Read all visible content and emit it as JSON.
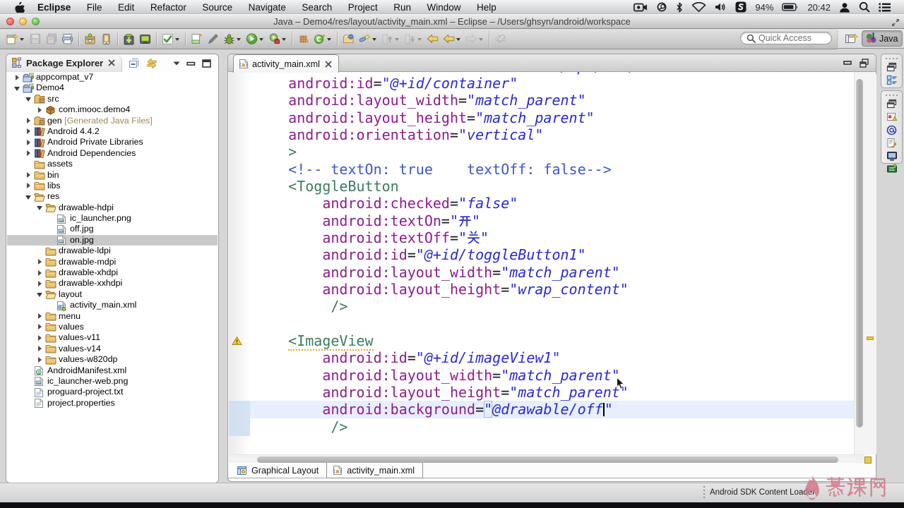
{
  "menubar": {
    "apple_icon": "apple-icon",
    "items": [
      "Eclipse",
      "File",
      "Edit",
      "Refactor",
      "Source",
      "Navigate",
      "Search",
      "Project",
      "Run",
      "Window",
      "Help"
    ],
    "tray": [
      {
        "icon": "screen-recording-icon"
      },
      {
        "icon": "app-circle-icon"
      },
      {
        "icon": "bluetooth-icon"
      },
      {
        "icon": "wifi-icon"
      },
      {
        "icon": "volume-icon"
      },
      {
        "icon": "input-method-icon"
      },
      {
        "text": "94%"
      },
      {
        "icon": "battery-icon"
      },
      {
        "text": "20:42"
      },
      {
        "icon": "user-icon"
      },
      {
        "icon": "spotlight-icon"
      },
      {
        "icon": "notification-center-icon"
      }
    ]
  },
  "titlebar": {
    "title": "Java – Demo4/res/layout/activity_main.xml – Eclipse – /Users/ghsyn/android/workspace"
  },
  "toolbar": {
    "buttons": [
      {
        "name": "new-wizard",
        "icon": "new-wizard-icon",
        "caret": true
      },
      {
        "name": "save",
        "icon": "save-icon",
        "disabled": true
      },
      {
        "name": "save-all",
        "icon": "save-all-icon",
        "disabled": true
      },
      {
        "name": "print",
        "icon": "print-icon"
      },
      {
        "sep": true
      },
      {
        "name": "android-sdk-manager",
        "icon": "android-sdk-icon"
      },
      {
        "name": "avd-manager",
        "icon": "avd-device-icon"
      },
      {
        "sep": true
      },
      {
        "name": "sdk-download",
        "icon": "sdk-download-icon"
      },
      {
        "name": "device-screen-capture",
        "icon": "device-screen-icon"
      },
      {
        "sep": true
      },
      {
        "name": "new-test",
        "icon": "check-xml-icon",
        "caret": true
      },
      {
        "sep": true
      },
      {
        "name": "new-android-xml",
        "icon": "xml-new-icon"
      },
      {
        "name": "toggle-mark-occurrences",
        "icon": "mark-occurrences-icon"
      },
      {
        "name": "debug",
        "icon": "debug-icon",
        "caret": true
      },
      {
        "name": "run",
        "icon": "run-icon",
        "caret": true
      },
      {
        "name": "external-tools",
        "icon": "external-tools-icon",
        "caret": true
      },
      {
        "sep": true
      },
      {
        "name": "coverage",
        "icon": "coverage-icon"
      },
      {
        "name": "new-class",
        "icon": "new-class-icon",
        "caret": true
      },
      {
        "sep": true
      },
      {
        "name": "open-task",
        "icon": "open-task-icon"
      },
      {
        "name": "search",
        "icon": "search-flashlight-icon",
        "caret": true
      },
      {
        "name": "previous-annotation",
        "icon": "prev-annotation-icon",
        "caret": true,
        "disabled": true
      },
      {
        "name": "next-annotation",
        "icon": "next-annotation-icon",
        "caret": true,
        "disabled": true
      },
      {
        "name": "back",
        "icon": "back-arrow-icon"
      },
      {
        "name": "back-history",
        "icon": "back-arrow-icon",
        "caret": true
      },
      {
        "name": "forward",
        "icon": "forward-arrow-icon",
        "caret": true,
        "disabled": true
      },
      {
        "sep": true,
        "tall": true
      },
      {
        "name": "last-edit-location",
        "icon": "last-edit-icon",
        "disabled": true
      }
    ],
    "quick_access": {
      "placeholder": "Quick Access",
      "icon": "search-icon"
    },
    "perspectives": {
      "open_icon": "open-perspective-icon",
      "java_label": "Java",
      "java_icon": "java-perspective-icon"
    }
  },
  "explorer": {
    "title": "Package Explorer",
    "icon": "package-explorer-icon",
    "tools": [
      "collapse-all-icon",
      "link-editor-icon",
      "view-menu-icon",
      "minimize-icon",
      "maximize-icon"
    ],
    "tree": [
      {
        "label": "appcompat_v7",
        "level": 0,
        "arrow": "right",
        "icon": "project-icon"
      },
      {
        "label": "Demo4",
        "level": 0,
        "arrow": "down",
        "icon": "project-icon"
      },
      {
        "label": "src",
        "level": 1,
        "arrow": "down",
        "icon": "source-folder-icon"
      },
      {
        "label": "com.imooc.demo4",
        "level": 2,
        "arrow": "right",
        "icon": "package-icon"
      },
      {
        "label": "gen",
        "suffix": " [Generated Java Files]",
        "level": 1,
        "arrow": "right",
        "icon": "source-folder-icon"
      },
      {
        "label": "Android 4.4.2",
        "level": 1,
        "arrow": "right",
        "icon": "library-icon"
      },
      {
        "label": "Android Private Libraries",
        "level": 1,
        "arrow": "right",
        "icon": "library-icon"
      },
      {
        "label": "Android Dependencies",
        "level": 1,
        "arrow": "right",
        "icon": "library-icon"
      },
      {
        "label": "assets",
        "level": 1,
        "arrow": "none",
        "icon": "folder-icon"
      },
      {
        "label": "bin",
        "level": 1,
        "arrow": "right",
        "icon": "folder-icon"
      },
      {
        "label": "libs",
        "level": 1,
        "arrow": "right",
        "icon": "folder-icon"
      },
      {
        "label": "res",
        "level": 1,
        "arrow": "down",
        "icon": "folder-open-icon"
      },
      {
        "label": "drawable-hdpi",
        "level": 2,
        "arrow": "down",
        "icon": "folder-open-icon"
      },
      {
        "label": "ic_launcher.png",
        "level": 3,
        "arrow": "none",
        "icon": "image-file-icon"
      },
      {
        "label": "off.jpg",
        "level": 3,
        "arrow": "none",
        "icon": "image-file-icon"
      },
      {
        "label": "on.jpg",
        "level": 3,
        "arrow": "none",
        "icon": "image-file-icon",
        "selected": true
      },
      {
        "label": "drawable-ldpi",
        "level": 2,
        "arrow": "none",
        "icon": "folder-icon"
      },
      {
        "label": "drawable-mdpi",
        "level": 2,
        "arrow": "right",
        "icon": "folder-icon"
      },
      {
        "label": "drawable-xhdpi",
        "level": 2,
        "arrow": "right",
        "icon": "folder-icon"
      },
      {
        "label": "drawable-xxhdpi",
        "level": 2,
        "arrow": "right",
        "icon": "folder-icon"
      },
      {
        "label": "layout",
        "level": 2,
        "arrow": "down",
        "icon": "folder-open-icon"
      },
      {
        "label": "activity_main.xml",
        "level": 3,
        "arrow": "none",
        "icon": "layout-file-icon"
      },
      {
        "label": "menu",
        "level": 2,
        "arrow": "right",
        "icon": "folder-icon"
      },
      {
        "label": "values",
        "level": 2,
        "arrow": "right",
        "icon": "folder-icon"
      },
      {
        "label": "values-v11",
        "level": 2,
        "arrow": "right",
        "icon": "folder-icon"
      },
      {
        "label": "values-v14",
        "level": 2,
        "arrow": "right",
        "icon": "folder-icon"
      },
      {
        "label": "values-w820dp",
        "level": 2,
        "arrow": "right",
        "icon": "folder-icon"
      },
      {
        "label": "AndroidManifest.xml",
        "level": 1,
        "arrow": "none",
        "icon": "manifest-file-icon"
      },
      {
        "label": "ic_launcher-web.png",
        "level": 1,
        "arrow": "none",
        "icon": "image-file-icon"
      },
      {
        "label": "proguard-project.txt",
        "level": 1,
        "arrow": "none",
        "icon": "text-file-icon"
      },
      {
        "label": "project.properties",
        "level": 1,
        "arrow": "none",
        "icon": "text-file-icon"
      }
    ]
  },
  "editor": {
    "tab_label": "activity_main.xml",
    "tab_icon": "xml-file-icon",
    "lines": [
      {
        "tokens": [
          {
            "s": "    ",
            "c": "p"
          },
          {
            "s": "xmlns:tools",
            "c": "a"
          },
          {
            "s": "=",
            "c": "p"
          },
          {
            "s": "\"schemas.android.com/apk/res/android\"",
            "c": "v"
          }
        ]
      },
      {
        "tokens": [
          {
            "s": "    ",
            "c": "p"
          },
          {
            "s": "android:id",
            "c": "a"
          },
          {
            "s": "=",
            "c": "p"
          },
          {
            "s": "\"@+id/container\"",
            "c": "v"
          }
        ]
      },
      {
        "tokens": [
          {
            "s": "    ",
            "c": "p"
          },
          {
            "s": "android:layout_width",
            "c": "a"
          },
          {
            "s": "=",
            "c": "p"
          },
          {
            "s": "\"match_parent\"",
            "c": "v"
          }
        ]
      },
      {
        "tokens": [
          {
            "s": "    ",
            "c": "p"
          },
          {
            "s": "android:layout_height",
            "c": "a"
          },
          {
            "s": "=",
            "c": "p"
          },
          {
            "s": "\"match_parent\"",
            "c": "v"
          }
        ]
      },
      {
        "tokens": [
          {
            "s": "    ",
            "c": "p"
          },
          {
            "s": "android:orientation",
            "c": "a"
          },
          {
            "s": "=",
            "c": "p"
          },
          {
            "s": "\"vertical\"",
            "c": "v"
          }
        ]
      },
      {
        "tokens": [
          {
            "s": "    ",
            "c": "p"
          },
          {
            "s": ">",
            "c": "t"
          }
        ]
      },
      {
        "tokens": [
          {
            "s": "    ",
            "c": "p"
          },
          {
            "s": "<!-- textOn: true    textOff: false-->",
            "c": "c"
          }
        ]
      },
      {
        "tokens": [
          {
            "s": "    ",
            "c": "p"
          },
          {
            "s": "<ToggleButton",
            "c": "t"
          }
        ]
      },
      {
        "tokens": [
          {
            "s": "        ",
            "c": "p"
          },
          {
            "s": "android:checked",
            "c": "a"
          },
          {
            "s": "=",
            "c": "p"
          },
          {
            "s": "\"false\"",
            "c": "v"
          }
        ]
      },
      {
        "tokens": [
          {
            "s": "        ",
            "c": "p"
          },
          {
            "s": "android:textOn",
            "c": "a"
          },
          {
            "s": "=",
            "c": "p"
          },
          {
            "s": "\"开\"",
            "c": "v"
          }
        ]
      },
      {
        "tokens": [
          {
            "s": "        ",
            "c": "p"
          },
          {
            "s": "android:textOff",
            "c": "a"
          },
          {
            "s": "=",
            "c": "p"
          },
          {
            "s": "\"关\"",
            "c": "v"
          }
        ]
      },
      {
        "tokens": [
          {
            "s": "        ",
            "c": "p"
          },
          {
            "s": "android:id",
            "c": "a"
          },
          {
            "s": "=",
            "c": "p"
          },
          {
            "s": "\"@+id/toggleButton1\"",
            "c": "v"
          }
        ]
      },
      {
        "tokens": [
          {
            "s": "        ",
            "c": "p"
          },
          {
            "s": "android:layout_width",
            "c": "a"
          },
          {
            "s": "=",
            "c": "p"
          },
          {
            "s": "\"match_parent\"",
            "c": "v"
          }
        ]
      },
      {
        "tokens": [
          {
            "s": "        ",
            "c": "p"
          },
          {
            "s": "android:layout_height",
            "c": "a"
          },
          {
            "s": "=",
            "c": "p"
          },
          {
            "s": "\"wrap_content\"",
            "c": "v"
          }
        ]
      },
      {
        "tokens": [
          {
            "s": "         ",
            "c": "p"
          },
          {
            "s": "/>",
            "c": "t"
          }
        ]
      },
      {
        "tokens": []
      },
      {
        "tokens": [
          {
            "s": "    ",
            "c": "p"
          },
          {
            "s": "<ImageView",
            "c": "t",
            "warn": true
          }
        ]
      },
      {
        "tokens": [
          {
            "s": "        ",
            "c": "p"
          },
          {
            "s": "android:id",
            "c": "a"
          },
          {
            "s": "=",
            "c": "p"
          },
          {
            "s": "\"@+id/imageView1\"",
            "c": "v"
          }
        ]
      },
      {
        "tokens": [
          {
            "s": "        ",
            "c": "p"
          },
          {
            "s": "android:layout_width",
            "c": "a"
          },
          {
            "s": "=",
            "c": "p"
          },
          {
            "s": "\"match_parent\"",
            "c": "v"
          }
        ]
      },
      {
        "tokens": [
          {
            "s": "        ",
            "c": "p"
          },
          {
            "s": "android:layout_height",
            "c": "a"
          },
          {
            "s": "=",
            "c": "p"
          },
          {
            "s": "\"match_parent\"",
            "c": "v"
          }
        ]
      },
      {
        "current": true,
        "tokens": [
          {
            "s": "        ",
            "c": "p"
          },
          {
            "s": "android:background",
            "c": "a"
          },
          {
            "s": "=",
            "c": "p"
          },
          {
            "s": "\"",
            "c": "v",
            "box": true
          },
          {
            "s": "@drawable/off",
            "c": "v"
          },
          {
            "caret": true
          },
          {
            "s": "\"",
            "c": "v"
          }
        ]
      },
      {
        "tokens": [
          {
            "s": "         ",
            "c": "p"
          },
          {
            "s": "/>",
            "c": "t"
          }
        ]
      }
    ],
    "bottom_tabs": [
      {
        "label": "Graphical Layout",
        "icon": "graphical-layout-icon",
        "active": false
      },
      {
        "label": "activity_main.xml",
        "icon": "xml-file-icon",
        "active": true
      }
    ]
  },
  "right_strips": [
    {
      "name": "outline-strip",
      "items": [
        {
          "name": "restore-pane",
          "icon": "restore-pane-icon"
        },
        {
          "name": "outline-view",
          "icon": "outline-view-icon"
        }
      ]
    },
    {
      "name": "views-strip",
      "items": [
        {
          "name": "restore-pane",
          "icon": "restore-pane-icon"
        },
        {
          "name": "problems-view",
          "icon": "problems-view-icon"
        },
        {
          "name": "javadoc-view",
          "icon": "javadoc-view-icon"
        },
        {
          "name": "declaration-view",
          "icon": "declaration-view-icon"
        },
        {
          "name": "console-view",
          "icon": "console-view-icon"
        },
        {
          "name": "logcat-view",
          "icon": "logcat-view-icon"
        }
      ]
    }
  ],
  "statusbar": {
    "message": "Android SDK Content Loader"
  },
  "watermark": {
    "text": "慕课网",
    "icon": "flame-icon",
    "color": "#e5506e"
  },
  "colors": {
    "attr": "#8d1d8d",
    "value": "#2929cf",
    "tag": "#3c7b5c",
    "comment": "#4058c0",
    "selection_bg": "#c9c9c9",
    "current_line": "#e6effb",
    "watermark": "#e5506e"
  }
}
